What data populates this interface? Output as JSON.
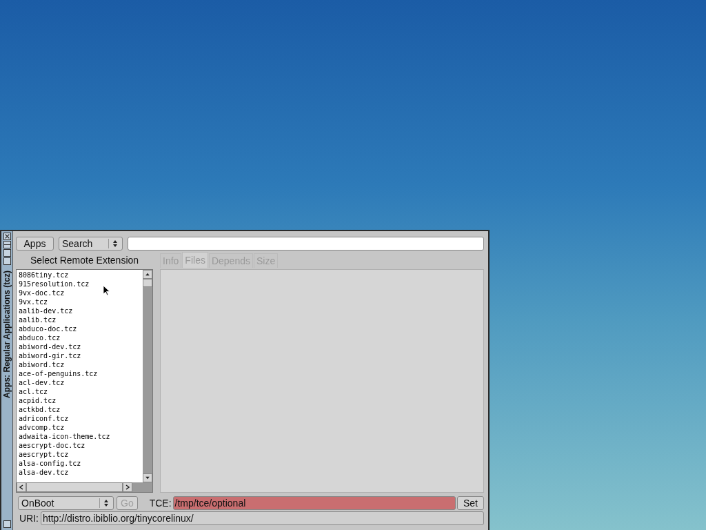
{
  "window": {
    "title": "Apps: Regular Applications (tcz)"
  },
  "toolbar": {
    "apps_button": "Apps",
    "search_select": "Search"
  },
  "list_heading": "Select Remote Extension",
  "extensions": [
    "8086tiny.tcz",
    "915resolution.tcz",
    "9vx-doc.tcz",
    "9vx.tcz",
    "aalib-dev.tcz",
    "aalib.tcz",
    "abduco-doc.tcz",
    "abduco.tcz",
    "abiword-dev.tcz",
    "abiword-gir.tcz",
    "abiword.tcz",
    "ace-of-penguins.tcz",
    "acl-dev.tcz",
    "acl.tcz",
    "acpid.tcz",
    "actkbd.tcz",
    "adriconf.tcz",
    "advcomp.tcz",
    "adwaita-icon-theme.tcz",
    "aescrypt-doc.tcz",
    "aescrypt.tcz",
    "alsa-config.tcz",
    "alsa-dev.tcz"
  ],
  "tabs": [
    {
      "label": "Info",
      "selected": false,
      "disabled": true
    },
    {
      "label": "Files",
      "selected": true,
      "disabled": true
    },
    {
      "label": "Depends",
      "selected": false,
      "disabled": true
    },
    {
      "label": "Size",
      "selected": false,
      "disabled": true
    }
  ],
  "bottom": {
    "mode_select": "OnBoot",
    "go_button": {
      "label": "Go",
      "disabled": true
    },
    "tce_label": "TCE:",
    "tce_field": "/tmp/tce/optional",
    "set_button": "Set",
    "uri_label": "URI:",
    "uri_field": "http://distro.ibiblio.org/tinycorelinux/"
  }
}
